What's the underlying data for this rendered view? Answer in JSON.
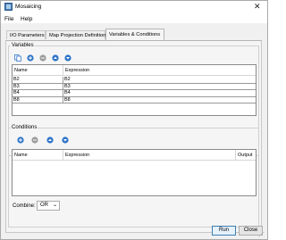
{
  "window": {
    "title": "Mosaicing"
  },
  "menu": [
    "File",
    "Help"
  ],
  "tabs": [
    "I/O Parameters",
    "Map Projection Definition",
    "Variables & Conditions"
  ],
  "variables": {
    "label": "Variables",
    "columns": [
      "Name",
      "Expression"
    ],
    "rows": [
      {
        "name": "B2",
        "expression": "B2"
      },
      {
        "name": "B3",
        "expression": "B3"
      },
      {
        "name": "B4",
        "expression": "B4"
      },
      {
        "name": "B8",
        "expression": "B8"
      }
    ]
  },
  "conditions": {
    "label": "Conditions",
    "columns": [
      "Name",
      "Expression",
      "Output"
    ]
  },
  "combine": {
    "label": "Combine:",
    "value": "OR"
  },
  "buttons": {
    "run": "Run",
    "close": "Close"
  },
  "colors": {
    "accent": "#3c7fb1",
    "toolbar_icon": "#2e74c8",
    "remove_icon": "#8a8a8a"
  }
}
